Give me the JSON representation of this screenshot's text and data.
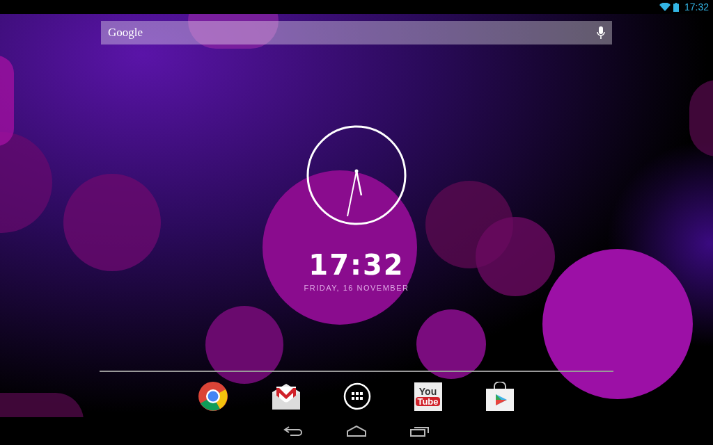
{
  "status_bar": {
    "time": "17:32"
  },
  "search_bar": {
    "logo_text": "Google"
  },
  "clock_widget": {
    "time": "17:32",
    "date": "FRIDAY, 16 NOVEMBER"
  },
  "dock": [
    {
      "kind": "chrome"
    },
    {
      "kind": "gmail"
    },
    {
      "kind": "apps"
    },
    {
      "kind": "youtube",
      "text_top": "You",
      "text_bottom": "Tube"
    },
    {
      "kind": "play_store"
    }
  ],
  "nav_bar": [
    {
      "kind": "back"
    },
    {
      "kind": "home"
    },
    {
      "kind": "recents"
    }
  ]
}
